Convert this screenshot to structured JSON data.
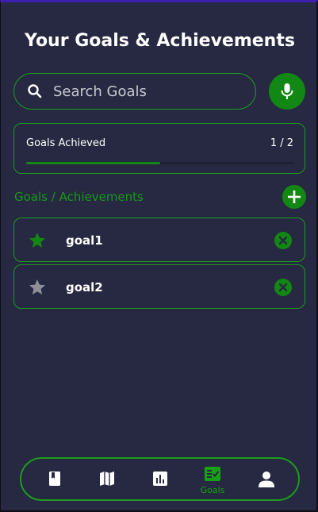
{
  "header": {
    "title": "Your Goals & Achievements"
  },
  "search": {
    "placeholder": "Search Goals",
    "icon": "search-icon"
  },
  "mic": {
    "icon": "microphone-icon"
  },
  "progress": {
    "label": "Goals Achieved",
    "achieved": 1,
    "total": 2,
    "count_text": "1 / 2",
    "fraction": 0.5
  },
  "section": {
    "title": "Goals / Achievements"
  },
  "goals": [
    {
      "name": "goal1",
      "starred": true
    },
    {
      "name": "goal2",
      "starred": false
    }
  ],
  "nav": {
    "items": [
      {
        "icon": "book-icon"
      },
      {
        "icon": "map-icon"
      },
      {
        "icon": "bar-chart-icon"
      },
      {
        "icon": "goals-checklist-icon",
        "label": "Goals",
        "active": true
      },
      {
        "icon": "profile-icon"
      }
    ]
  },
  "colors": {
    "background": "#262941",
    "accent": "#138713",
    "border": "#1d9b1d",
    "text": "#ffffff",
    "inactive_star": "#8e8f99"
  }
}
